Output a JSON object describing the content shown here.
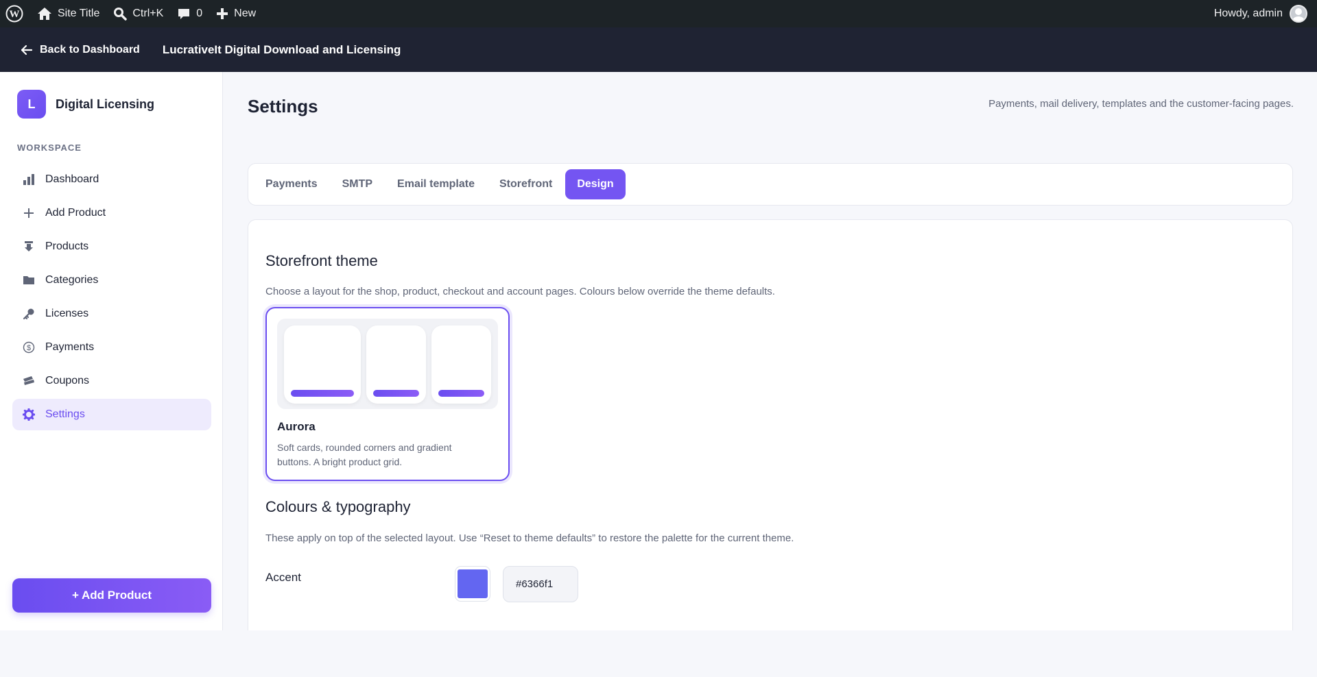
{
  "admin_bar": {
    "site_title": "Site Title",
    "search_shortcut": "Ctrl+K",
    "comments_count": "0",
    "new_label": "New",
    "howdy": "Howdy, admin"
  },
  "plugin_header": {
    "back_label": "Back to Dashboard",
    "title": "LucrativeIt Digital Download and Licensing"
  },
  "sidebar": {
    "brand_initial": "L",
    "brand_name": "Digital Licensing",
    "section_label": "WORKSPACE",
    "items": [
      {
        "label": "Dashboard",
        "icon": "bar-chart-icon"
      },
      {
        "label": "Add Product",
        "icon": "plus-icon"
      },
      {
        "label": "Products",
        "icon": "download-icon"
      },
      {
        "label": "Categories",
        "icon": "folder-icon"
      },
      {
        "label": "Licenses",
        "icon": "key-icon"
      },
      {
        "label": "Payments",
        "icon": "dollar-icon"
      },
      {
        "label": "Coupons",
        "icon": "ticket-icon"
      },
      {
        "label": "Settings",
        "icon": "gear-icon"
      }
    ],
    "active_item": "Settings",
    "add_button": "+ Add Product"
  },
  "main": {
    "title": "Settings",
    "subtitle": "Payments, mail delivery, templates and the customer-facing pages.",
    "tabs": [
      "Payments",
      "SMTP",
      "Email template",
      "Storefront",
      "Design"
    ],
    "active_tab": "Design"
  },
  "design": {
    "theme_section_title": "Storefront theme",
    "theme_section_desc": "Choose a layout for the shop, product, checkout and account pages. Colours below override the theme defaults.",
    "theme": {
      "name": "Aurora",
      "desc": "Soft cards, rounded corners and gradient buttons. A bright product grid."
    },
    "colours_section_title": "Colours & typography",
    "colours_section_desc": "These apply on top of the selected layout. Use “Reset to theme defaults” to restore the palette for the current theme.",
    "accent_label": "Accent",
    "accent_value": "#6366f1"
  },
  "colors": {
    "accent": "#6366f1",
    "brand": "#6a4df0",
    "admin_bar": "#1d2327",
    "plugin_header": "#1f2333"
  }
}
